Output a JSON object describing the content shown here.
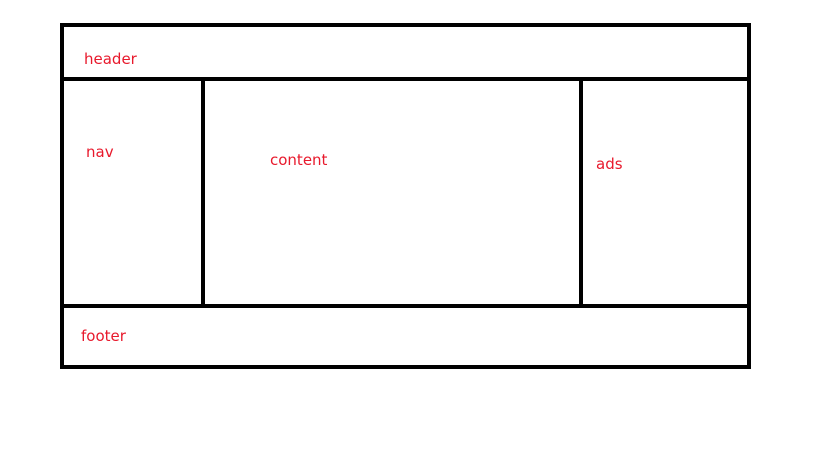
{
  "labels": {
    "header": "header",
    "nav": "nav",
    "content": "content",
    "ads": "ads",
    "footer": "footer"
  },
  "colors": {
    "label": "#e8192c",
    "border": "#000000",
    "background": "#ffffff"
  }
}
